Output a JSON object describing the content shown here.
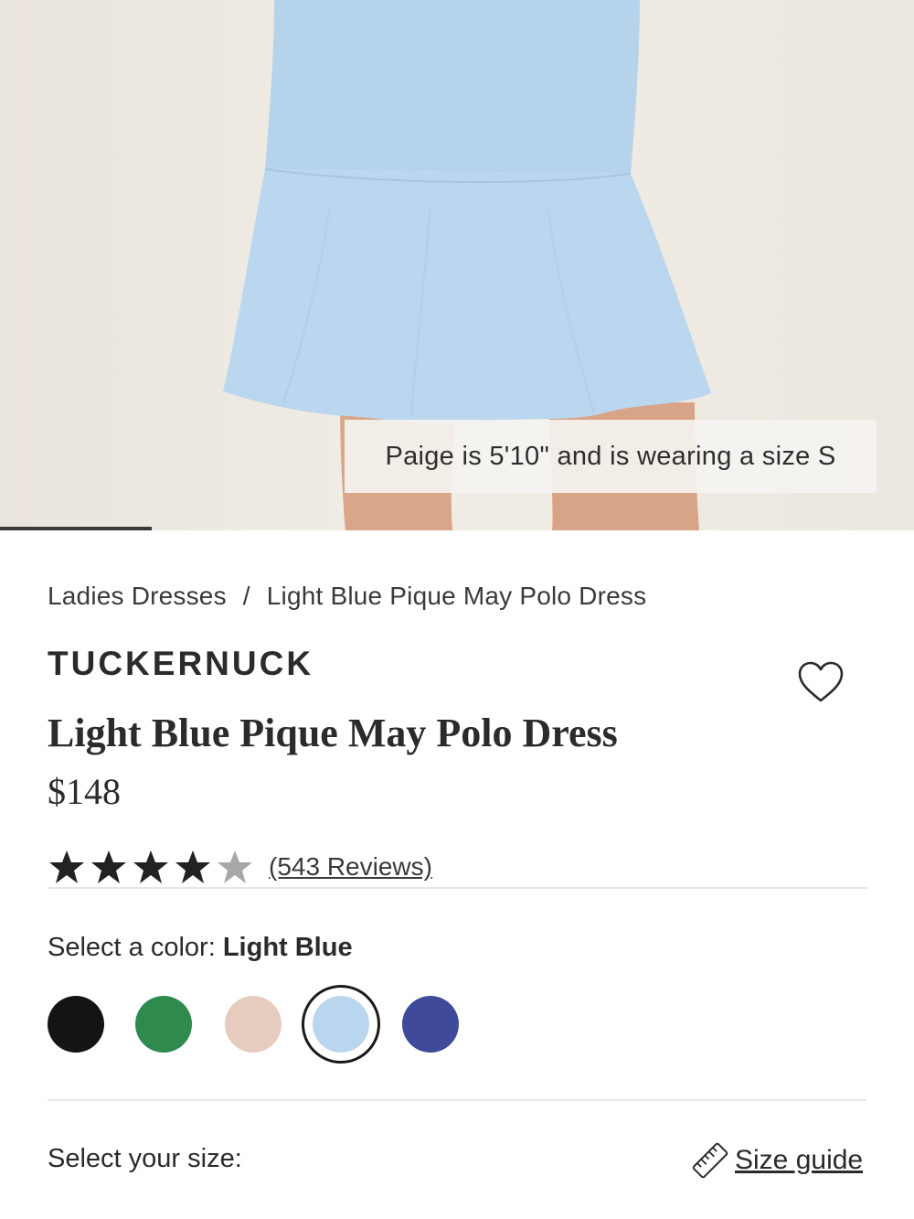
{
  "hero": {
    "caption": "Paige is 5'10\" and is wearing a size S",
    "carousel_progress": 0.166
  },
  "breadcrumb": {
    "items": [
      "Ladies Dresses",
      "Light Blue Pique May Polo Dress"
    ],
    "separator": "/"
  },
  "product": {
    "brand": "TUCKERNUCK",
    "title": "Light Blue Pique May Polo Dress",
    "price": "$148",
    "rating": 4,
    "rating_max": 5,
    "reviews_label": "(543 Reviews)",
    "wishlist_icon": "heart-outline-icon"
  },
  "color": {
    "label": "Select a color:",
    "selected": "Light Blue",
    "swatches": [
      {
        "name": "black",
        "hex": "#141414"
      },
      {
        "name": "green",
        "hex": "#2f8a4e"
      },
      {
        "name": "blush",
        "hex": "#e6ccbf"
      },
      {
        "name": "light-blue",
        "hex": "#b9d6ee"
      },
      {
        "name": "navy",
        "hex": "#3f4a98"
      }
    ],
    "selected_index": 3
  },
  "size": {
    "label": "Select your size:",
    "guide_label": "Size guide",
    "guide_icon": "ruler-icon"
  },
  "colors": {
    "dress": "#b9d6ee",
    "text": "#2b2b2b",
    "divider": "#e6e6e6"
  }
}
